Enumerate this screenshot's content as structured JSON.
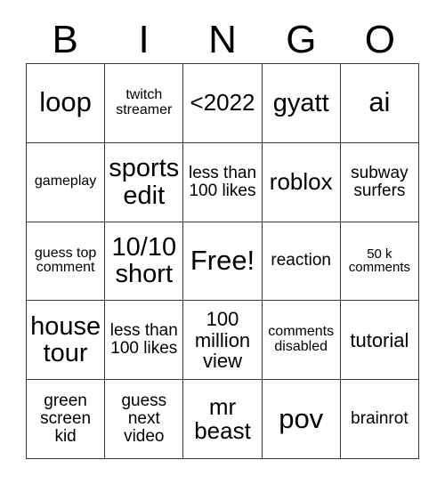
{
  "card": {
    "title": "BINGO",
    "header_letters": [
      "B",
      "I",
      "N",
      "G",
      "O"
    ],
    "rows": [
      [
        {
          "text": "loop",
          "size": "fs-xxl"
        },
        {
          "text": "twitch streamer",
          "size": "fs-xs"
        },
        {
          "text": "<2022",
          "size": "fs-lg"
        },
        {
          "text": "gyatt",
          "size": "fs-xl"
        },
        {
          "text": "ai",
          "size": "fs-xxl"
        }
      ],
      [
        {
          "text": "gameplay",
          "size": "fs-xs"
        },
        {
          "text": "sports edit",
          "size": "fs-xl"
        },
        {
          "text": "less than 100 likes",
          "size": "fs-sm"
        },
        {
          "text": "roblox",
          "size": "fs-lg"
        },
        {
          "text": "subway surfers",
          "size": "fs-sm"
        }
      ],
      [
        {
          "text": "guess top comment",
          "size": "fs-xs"
        },
        {
          "text": "10/10 short",
          "size": "fs-xl"
        },
        {
          "text": "Free!",
          "size": "fs-xxl"
        },
        {
          "text": "reaction",
          "size": "fs-sm"
        },
        {
          "text": "50 k comments",
          "size": "fs-xxs"
        }
      ],
      [
        {
          "text": "house tour",
          "size": "fs-xl"
        },
        {
          "text": "less than 100 likes",
          "size": "fs-sm"
        },
        {
          "text": "100 million view",
          "size": "fs-md"
        },
        {
          "text": "comments disabled",
          "size": "fs-xs"
        },
        {
          "text": "tutorial",
          "size": "fs-md"
        }
      ],
      [
        {
          "text": "green screen kid",
          "size": "fs-sm"
        },
        {
          "text": "guess next video",
          "size": "fs-sm"
        },
        {
          "text": "mr beast",
          "size": "fs-lg"
        },
        {
          "text": "pov",
          "size": "fs-xxl"
        },
        {
          "text": "brainrot",
          "size": "fs-sm"
        }
      ]
    ],
    "free_space": "Free!",
    "colors": {
      "background": "#ffffff",
      "border": "#3a3a3a",
      "text": "#000000"
    }
  }
}
